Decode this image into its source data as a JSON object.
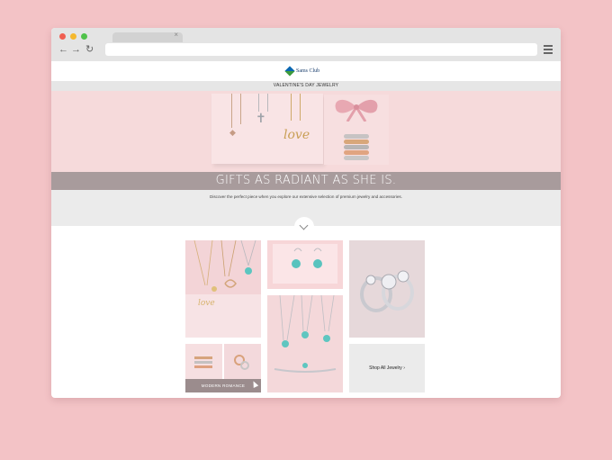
{
  "browser": {
    "url": "",
    "tab_title": "",
    "tab_close": "×",
    "back": "←",
    "forward": "→",
    "reload": "↻"
  },
  "brand": {
    "name": "Sams Club"
  },
  "category_bar": {
    "label": "VALENTINE'S DAY JEWELRY"
  },
  "hero": {
    "headline": "GIFTS AS RADIANT AS SHE IS.",
    "pendant_text": "love",
    "intro": "Discover the perfect piece when you explore our extensive selection of premium jewelry and accessories."
  },
  "tiles": {
    "modern_romance_caption": "MODERN ROMANCE",
    "shop_all_label": "Shop All Jewelry",
    "shop_all_arrow": "›"
  },
  "colors": {
    "page_background": "#f3c3c6",
    "hero_background": "#f6dadb",
    "headline_band": "#a89b9c",
    "intro_band": "#ebebeb"
  }
}
